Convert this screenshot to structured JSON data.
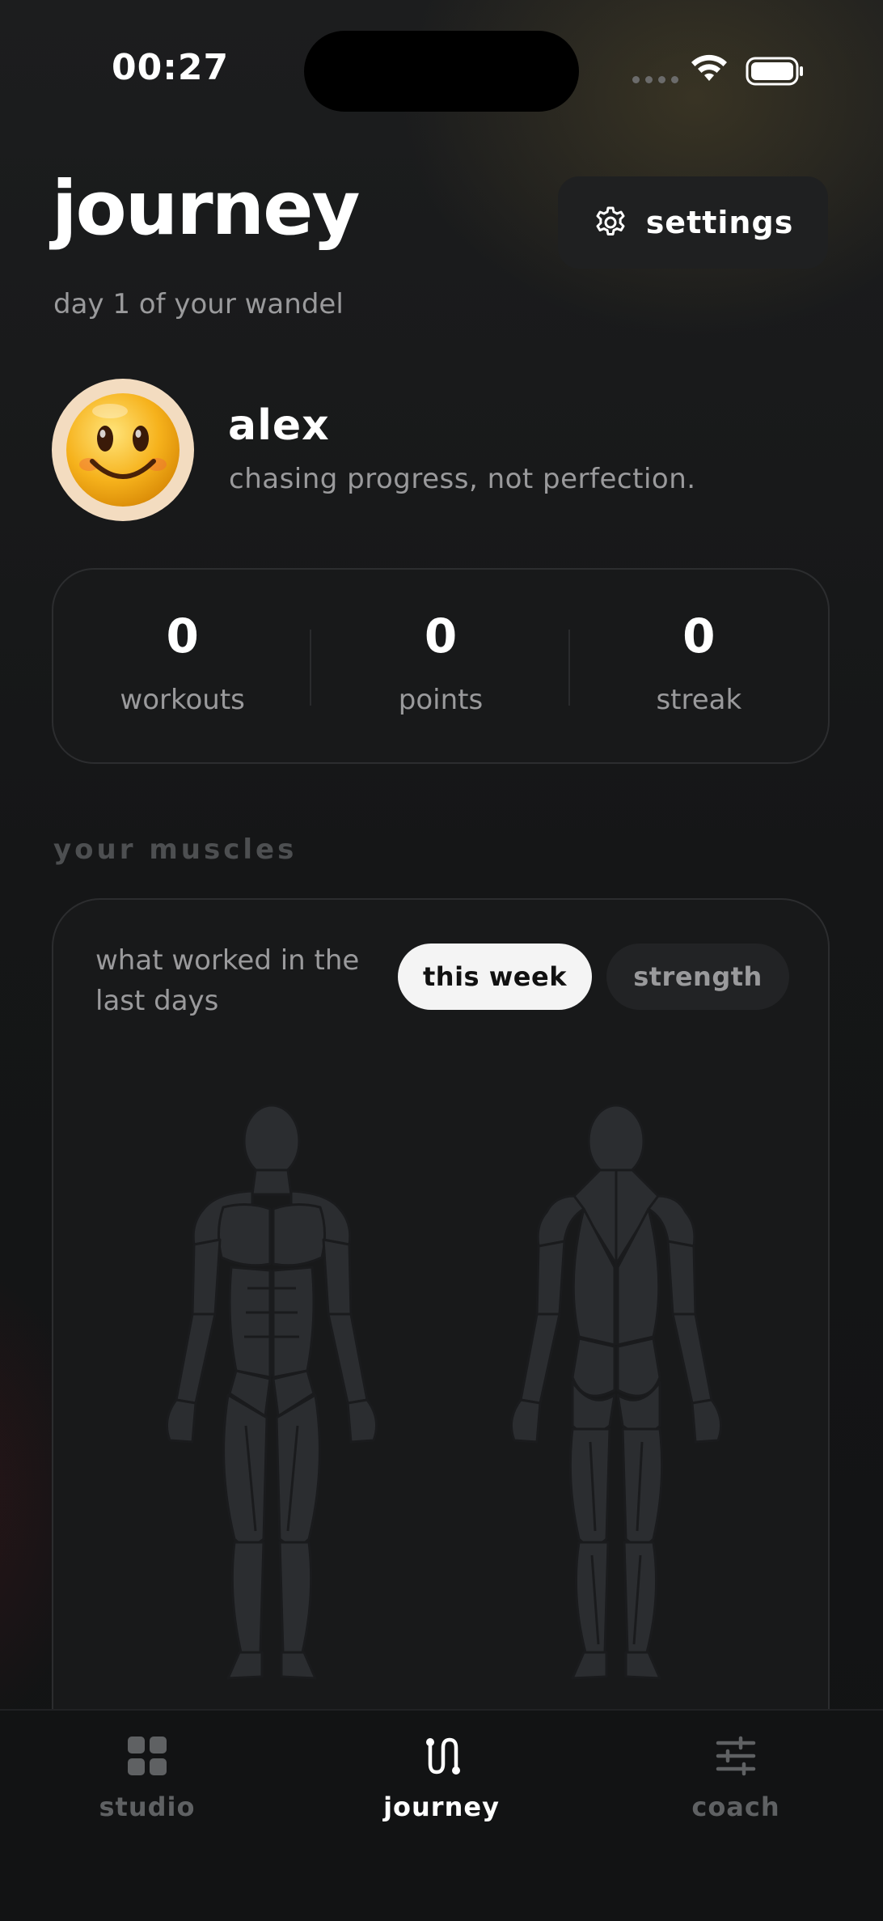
{
  "status_bar": {
    "time": "00:27"
  },
  "header": {
    "title": "journey",
    "subtitle": "day 1 of your wandel",
    "settings_label": "settings",
    "settings_icon": "gear-icon"
  },
  "profile": {
    "avatar": "smiley-face-emoji",
    "name": "alex",
    "bio": "chasing progress, not perfection."
  },
  "stats": [
    {
      "value": "0",
      "label": "workouts"
    },
    {
      "value": "0",
      "label": "points"
    },
    {
      "value": "0",
      "label": "streak"
    }
  ],
  "muscles": {
    "section_title": "your muscles",
    "caption": "what worked in the last days",
    "chips": [
      {
        "label": "this week",
        "selected": true
      },
      {
        "label": "strength",
        "selected": false
      }
    ],
    "figures": [
      "front-body-icon",
      "back-body-icon"
    ]
  },
  "tab_bar": {
    "tabs": [
      {
        "label": "studio",
        "icon": "grid-icon",
        "active": false
      },
      {
        "label": "journey",
        "icon": "route-icon",
        "active": true
      },
      {
        "label": "coach",
        "icon": "sliders-icon",
        "active": false
      }
    ]
  },
  "colors": {
    "background": "#141516",
    "card": "#18191a",
    "muted_text": "#9a9a9c",
    "chip_active": "#f4f4f4",
    "figure": "#2b2d30"
  }
}
